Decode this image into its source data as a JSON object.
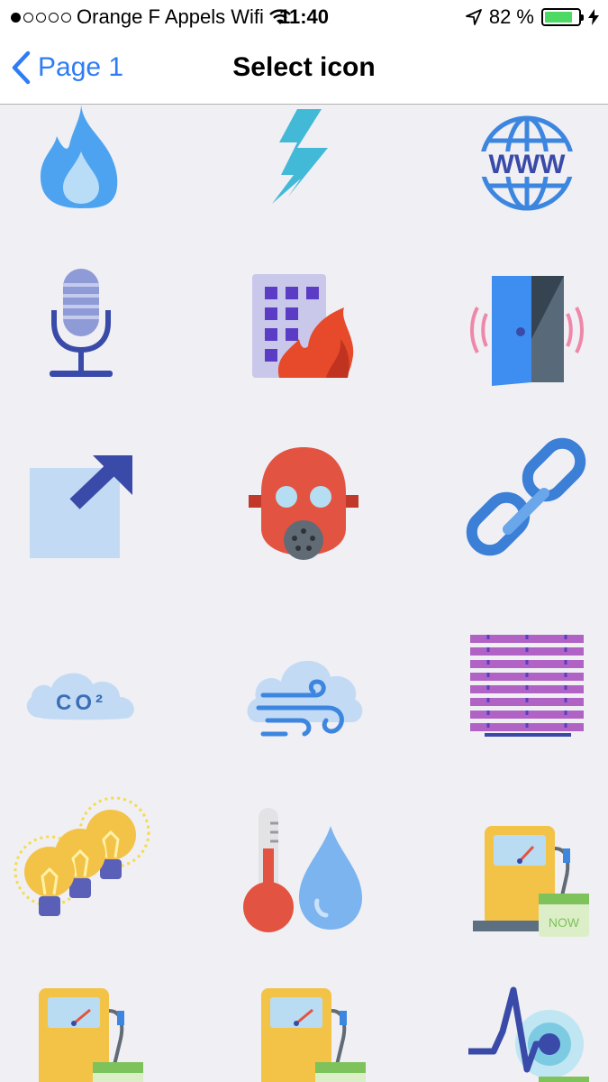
{
  "status_bar": {
    "carrier": "Orange F Appels Wifi",
    "time": "11:40",
    "battery_percent": "82 %",
    "battery_level": 0.82,
    "signal_dots_filled": 1,
    "signal_dots_total": 5
  },
  "nav": {
    "back_label": "Page 1",
    "title": "Select icon"
  },
  "colors": {
    "accent": "#2e7cf6",
    "background": "#efeff4",
    "battery_fill": "#4cd964"
  },
  "icons": [
    {
      "name": "fire-icon"
    },
    {
      "name": "lightning-icon"
    },
    {
      "name": "www-globe-icon",
      "text": "WWW"
    },
    {
      "name": "microphone-icon"
    },
    {
      "name": "building-fire-icon"
    },
    {
      "name": "open-door-icon"
    },
    {
      "name": "external-link-icon"
    },
    {
      "name": "gas-mask-icon"
    },
    {
      "name": "chain-link-icon"
    },
    {
      "name": "co2-cloud-icon",
      "text": "CO²"
    },
    {
      "name": "wind-cloud-icon"
    },
    {
      "name": "blinds-icon"
    },
    {
      "name": "light-bulbs-icon"
    },
    {
      "name": "temperature-humidity-icon"
    },
    {
      "name": "meter-now-icon",
      "text": "NOW"
    },
    {
      "name": "meter-calendar-icon"
    },
    {
      "name": "meter-calendar-icon-2"
    },
    {
      "name": "pulse-target-icon"
    }
  ]
}
